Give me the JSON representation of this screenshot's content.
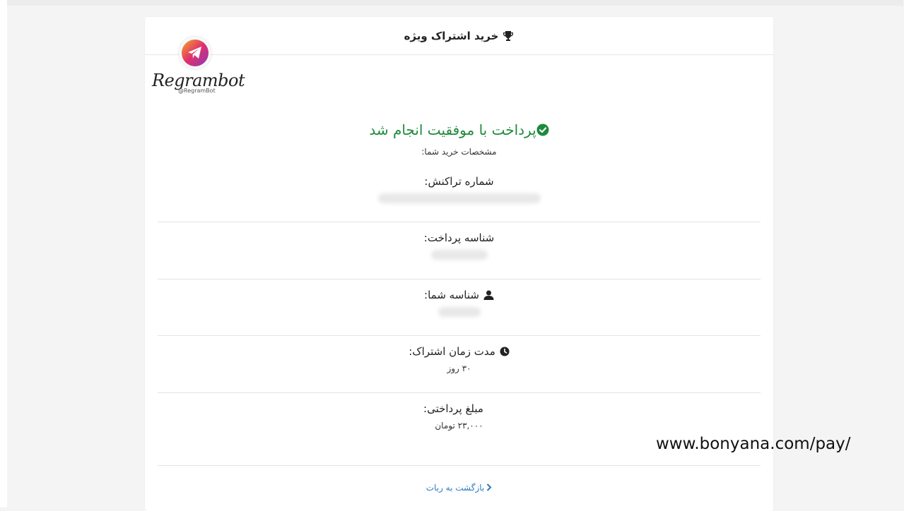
{
  "header": {
    "title": "خرید اشتراک ویژه",
    "icon": "trophy-icon"
  },
  "logo": {
    "name": "Regrambot",
    "handle": "@RegramBot",
    "icon": "telegram-plane-icon"
  },
  "status": {
    "message": "پرداخت با موفقیت انجام شد",
    "icon": "check-circle-icon",
    "color": "#1e8a3c"
  },
  "subtitle": "مشخصات خرید شما:",
  "fields": [
    {
      "label": "شماره تراکنش:",
      "value": "",
      "icon": ""
    },
    {
      "label": "شناسه پرداخت:",
      "value": "",
      "icon": ""
    },
    {
      "label": "شناسه شما:",
      "value": "",
      "icon": "user-icon"
    },
    {
      "label": "مدت زمان اشتراک:",
      "value": "۳۰ روز",
      "icon": "clock-icon"
    },
    {
      "label": "مبلغ پرداختی:",
      "value": "۲۳,۰۰۰ تومان",
      "icon": "dollar-icon"
    }
  ],
  "back_link": {
    "label": "بازگشت به ربات",
    "icon": "chevron-right-icon",
    "color": "#2a7ac0"
  },
  "watermark": "www.bonyana.com/pay/"
}
